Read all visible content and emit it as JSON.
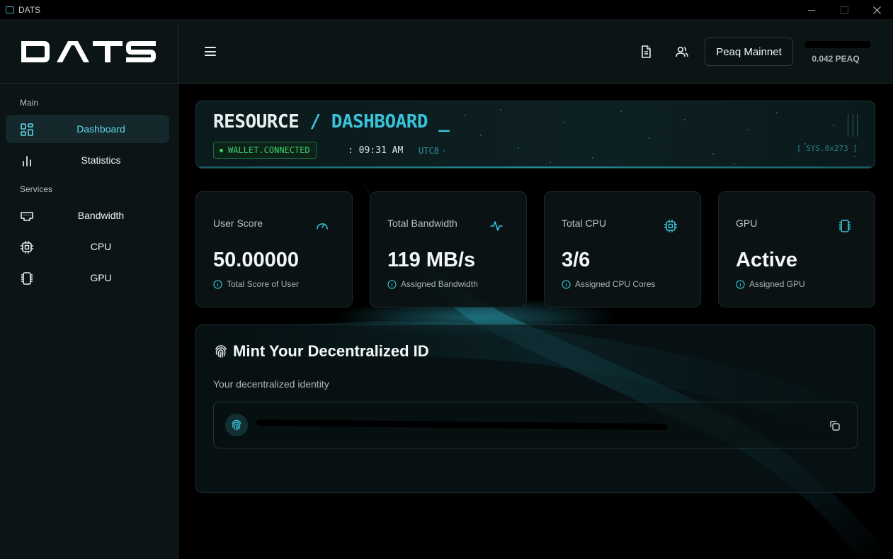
{
  "window": {
    "title": "DATS",
    "controls": [
      "minimize",
      "maximize",
      "close"
    ]
  },
  "logo": {
    "text": "DATS"
  },
  "sidebar": {
    "sections": [
      {
        "label": "Main",
        "items": [
          {
            "label": "Dashboard",
            "icon": "dashboard-grid-icon",
            "active": true
          },
          {
            "label": "Statistics",
            "icon": "bar-chart-icon",
            "active": false
          }
        ]
      },
      {
        "label": "Services",
        "items": [
          {
            "label": "Bandwidth",
            "icon": "ethernet-port-icon",
            "active": false
          },
          {
            "label": "CPU",
            "icon": "cpu-icon",
            "active": false
          },
          {
            "label": "GPU",
            "icon": "gpu-chip-icon",
            "active": false
          }
        ]
      }
    ]
  },
  "header": {
    "network_label": "Peaq Mainnet",
    "balance": "0.042 PEAQ"
  },
  "banner": {
    "title_part1": "RESOURCE",
    "separator": "/",
    "title_part2": "DASHBOARD",
    "cursor": "_",
    "status": "WALLET.CONNECTED",
    "time": ": 09:31 AM",
    "timezone": "UTC8",
    "sys_code": "[ SYS.0x273 ]"
  },
  "cards": [
    {
      "title": "User Score",
      "value": "50.00000",
      "subtitle": "Total Score of User",
      "icon": "gauge-icon"
    },
    {
      "title": "Total Bandwidth",
      "value": "119 MB/s",
      "subtitle": "Assigned Bandwidth",
      "icon": "activity-icon"
    },
    {
      "title": "Total CPU",
      "value": "3/6",
      "subtitle": "Assigned CPU Cores",
      "icon": "cpu-icon"
    },
    {
      "title": "GPU",
      "value": "Active",
      "subtitle": "Assigned GPU",
      "icon": "gpu-chip-icon"
    }
  ],
  "mint": {
    "title": "Mint Your Decentralized ID",
    "subtitle": "Your decentralized identity"
  },
  "colors": {
    "accent": "#39c3da",
    "sidebar_bg": "#0c1516",
    "status_green": "#3fd171"
  }
}
